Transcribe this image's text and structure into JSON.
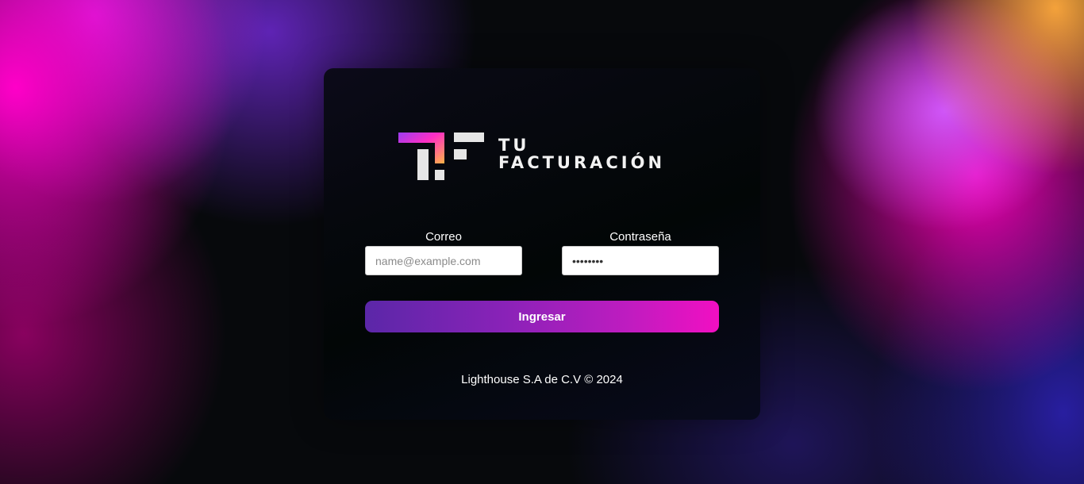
{
  "brand": {
    "line1": "TU",
    "line2": "FACTURACIÓN"
  },
  "form": {
    "email": {
      "label": "Correo",
      "placeholder": "name@example.com",
      "value": ""
    },
    "password": {
      "label": "Contraseña",
      "value": "********"
    },
    "submit_label": "Ingresar"
  },
  "footer": {
    "text": "Lighthouse S.A de C.V © 2024"
  },
  "colors": {
    "button_start": "#5b27a8",
    "button_end": "#f10fc2",
    "logo_accent": "#e040e0",
    "logo_gray": "#e6e6e6"
  }
}
